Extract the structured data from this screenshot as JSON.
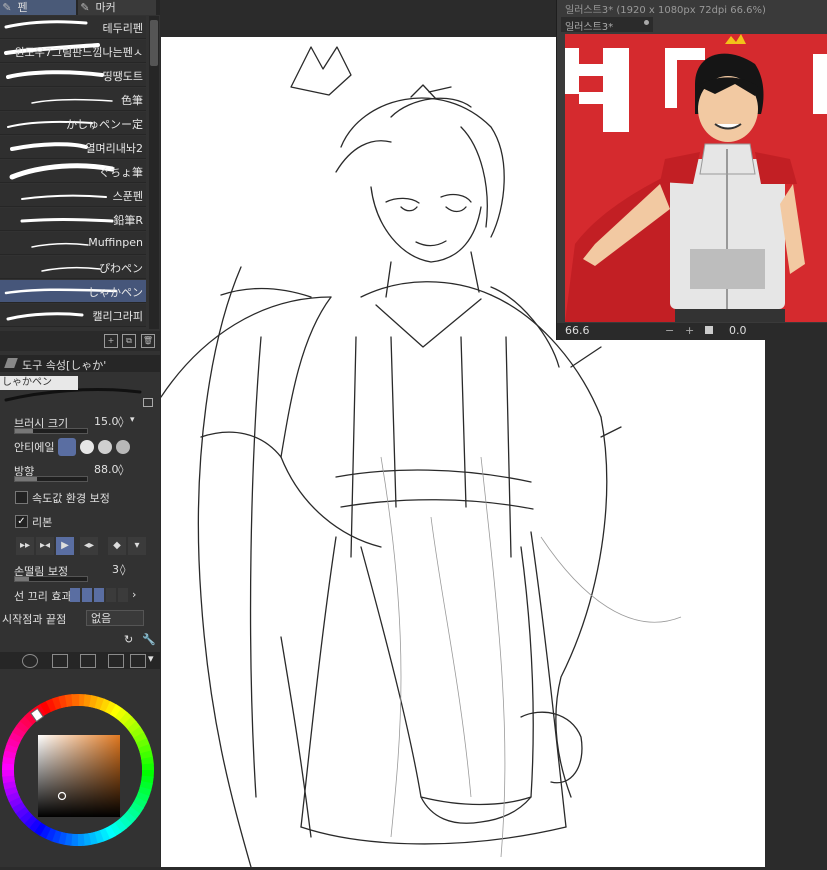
{
  "tabs": {
    "pen": "펜",
    "marker": "마커"
  },
  "brushes": [
    "테두리펜",
    "윈도우7그림판느낌나는펜ㅅ",
    "띵땡도트",
    "色筆",
    "かしゅペンー定",
    "열며리내놔2",
    "ぐちょ筆",
    "스푼펜",
    "鉛筆R",
    "Muffinpen",
    "ぴわペン",
    "しゃかペン",
    "캘리그라피"
  ],
  "selected_brush_index": 11,
  "tool_property": {
    "title": "도구 속성[しゃか'",
    "brush_tag": "しゃかペン",
    "brush_size_label": "브러시 크기",
    "brush_size_value": "15.0",
    "antialias_label": "안티에일",
    "direction_label": "방향",
    "direction_value": "88.0",
    "speed_label": "속도값 환경 보정",
    "ribbon_label": "리본",
    "ribbon_checked": true,
    "stabilize_label": "손떨림 보정",
    "stabilize_value": "3",
    "tail_label": "선 끄리 효과",
    "start_end_label": "시작점과 끝점",
    "start_end_value": "없음"
  },
  "subview": {
    "title": "일러스트3* (1920 x 1080px 72dpi 66.6%)",
    "tab_label": "일러스트3*",
    "zoom": "66.6",
    "rotation": "0.0"
  },
  "colors": {
    "panel": "#323232",
    "tab_active": "#4a5a78",
    "selected": "#46567a",
    "canvas": "#ffffff",
    "poster_red": "#d52a2e"
  }
}
